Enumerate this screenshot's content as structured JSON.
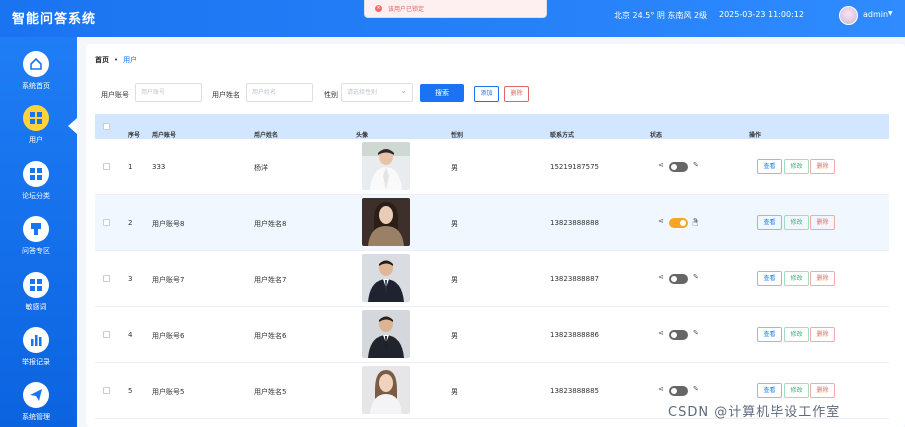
{
  "app_title": "智能问答系统",
  "toast": {
    "message": "该用户已锁定"
  },
  "header": {
    "weather": "北京 24.5° 阴 东南风 2级",
    "datetime": "2025-03-23 11:00:12",
    "user": "admin"
  },
  "sidebar": {
    "items": [
      {
        "label": "系统首页",
        "icon": "home-icon"
      },
      {
        "label": "用户",
        "icon": "grid-icon",
        "active": true
      },
      {
        "label": "论坛分类",
        "icon": "grid-icon"
      },
      {
        "label": "问答专区",
        "icon": "qa-icon"
      },
      {
        "label": "敏感词",
        "icon": "grid-icon"
      },
      {
        "label": "举报记录",
        "icon": "bar-chart-icon"
      },
      {
        "label": "系统管理",
        "icon": "paper-plane-icon"
      }
    ]
  },
  "breadcrumb": {
    "home": "首页",
    "current": "用户"
  },
  "filters": {
    "account_label": "用户账号",
    "account_placeholder": "用户账号",
    "name_label": "用户姓名",
    "name_placeholder": "用户姓名",
    "gender_label": "性别",
    "gender_placeholder": "请选择性别",
    "search": "搜索",
    "add": "添加",
    "delete": "删除"
  },
  "table": {
    "headers": {
      "index": "序号",
      "account": "用户账号",
      "name": "用户姓名",
      "avatar": "头像",
      "gender": "性别",
      "phone": "联系方式",
      "status": "状态",
      "actions": "操作"
    },
    "rows": [
      {
        "index": "1",
        "account": "333",
        "name": "杨洋",
        "gender": "男",
        "phone": "15219187575",
        "status_on": false
      },
      {
        "index": "2",
        "account": "用户账号8",
        "name": "用户姓名8",
        "gender": "男",
        "phone": "13823888888",
        "status_on": true
      },
      {
        "index": "3",
        "account": "用户账号7",
        "name": "用户姓名7",
        "gender": "男",
        "phone": "13823888887",
        "status_on": false
      },
      {
        "index": "4",
        "account": "用户账号6",
        "name": "用户姓名6",
        "gender": "男",
        "phone": "13823888886",
        "status_on": false
      },
      {
        "index": "5",
        "account": "用户账号5",
        "name": "用户姓名5",
        "gender": "男",
        "phone": "13823888885",
        "status_on": false
      }
    ],
    "actions": {
      "view": "查看",
      "modify": "修改",
      "delete": "删除"
    }
  },
  "watermark": "CSDN @计算机毕设工作室",
  "colors": {
    "primary": "#1a73f0",
    "toggle_on": "#f5a623",
    "danger": "#e06767",
    "success": "#34b27b"
  }
}
